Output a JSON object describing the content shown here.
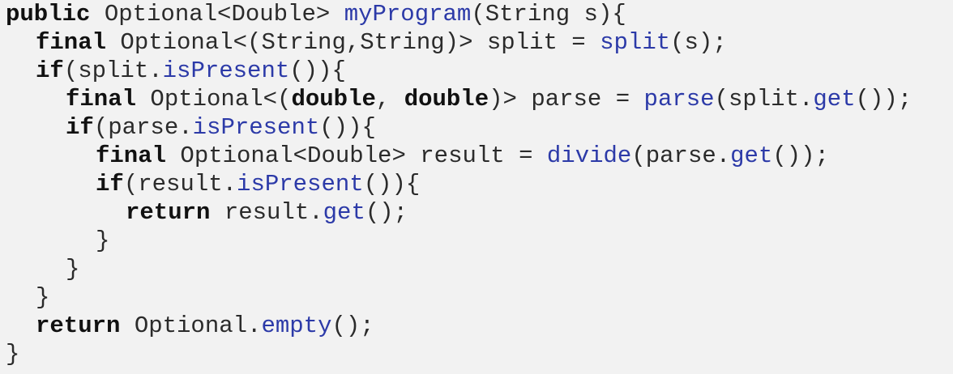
{
  "code": {
    "lines": [
      [
        {
          "type": "kw",
          "text": "public"
        },
        {
          "type": "plain",
          "text": " Optional<Double> "
        },
        {
          "type": "method",
          "text": "myProgram"
        },
        {
          "type": "plain",
          "text": "(String s){"
        }
      ],
      [
        {
          "type": "kw",
          "text": "final"
        },
        {
          "type": "plain",
          "text": " Optional<(String,String)> split = "
        },
        {
          "type": "method",
          "text": "split"
        },
        {
          "type": "plain",
          "text": "(s);"
        }
      ],
      [
        {
          "type": "kw",
          "text": "if"
        },
        {
          "type": "plain",
          "text": "(split."
        },
        {
          "type": "method",
          "text": "isPresent"
        },
        {
          "type": "plain",
          "text": "()){"
        }
      ],
      [
        {
          "type": "kw",
          "text": "final"
        },
        {
          "type": "plain",
          "text": " Optional<("
        },
        {
          "type": "kw",
          "text": "double"
        },
        {
          "type": "plain",
          "text": ", "
        },
        {
          "type": "kw",
          "text": "double"
        },
        {
          "type": "plain",
          "text": ")> parse = "
        },
        {
          "type": "method",
          "text": "parse"
        },
        {
          "type": "plain",
          "text": "(split."
        },
        {
          "type": "method",
          "text": "get"
        },
        {
          "type": "plain",
          "text": "());"
        }
      ],
      [
        {
          "type": "kw",
          "text": "if"
        },
        {
          "type": "plain",
          "text": "(parse."
        },
        {
          "type": "method",
          "text": "isPresent"
        },
        {
          "type": "plain",
          "text": "()){"
        }
      ],
      [
        {
          "type": "kw",
          "text": "final"
        },
        {
          "type": "plain",
          "text": " Optional<Double> result = "
        },
        {
          "type": "method",
          "text": "divide"
        },
        {
          "type": "plain",
          "text": "(parse."
        },
        {
          "type": "method",
          "text": "get"
        },
        {
          "type": "plain",
          "text": "());"
        }
      ],
      [
        {
          "type": "kw",
          "text": "if"
        },
        {
          "type": "plain",
          "text": "(result."
        },
        {
          "type": "method",
          "text": "isPresent"
        },
        {
          "type": "plain",
          "text": "()){"
        }
      ],
      [
        {
          "type": "kw",
          "text": "return"
        },
        {
          "type": "plain",
          "text": " result."
        },
        {
          "type": "method",
          "text": "get"
        },
        {
          "type": "plain",
          "text": "();"
        }
      ],
      [
        {
          "type": "plain",
          "text": "}"
        }
      ],
      [
        {
          "type": "plain",
          "text": "}"
        }
      ],
      [
        {
          "type": "plain",
          "text": "}"
        }
      ],
      [
        {
          "type": "kw",
          "text": "return"
        },
        {
          "type": "plain",
          "text": " Optional."
        },
        {
          "type": "method",
          "text": "empty"
        },
        {
          "type": "plain",
          "text": "();"
        }
      ],
      [
        {
          "type": "plain",
          "text": "}"
        }
      ]
    ]
  }
}
